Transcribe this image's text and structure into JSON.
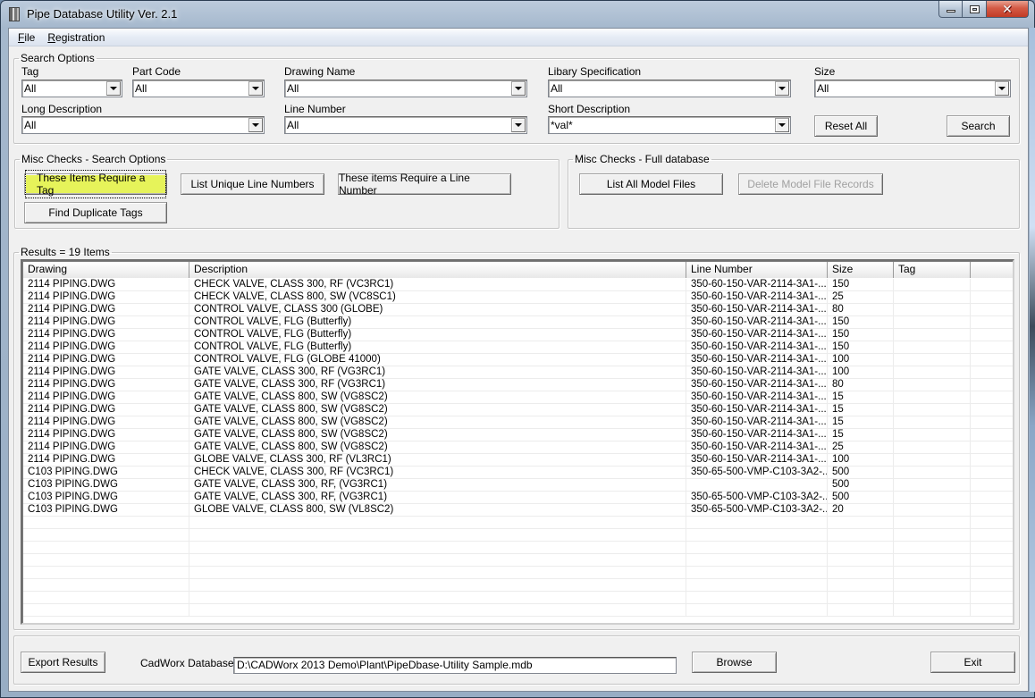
{
  "window": {
    "title": "Pipe Database Utility Ver. 2.1",
    "minimize_icon": "minimize-icon",
    "maximize_icon": "maximize-icon",
    "close_icon": "close-icon",
    "close_glyph": "✕"
  },
  "menu": {
    "items": [
      {
        "label": "File",
        "accel": "F",
        "rest": "ile"
      },
      {
        "label": "Registration",
        "accel": "R",
        "rest": "egistration"
      }
    ]
  },
  "search_options": {
    "legend": "Search Options",
    "fields": {
      "tag": {
        "label": "Tag",
        "value": "All"
      },
      "part_code": {
        "label": "Part Code",
        "value": "All"
      },
      "drawing_name": {
        "label": "Drawing Name",
        "value": "All"
      },
      "library_spec": {
        "label": "Libary Specification",
        "value": "All"
      },
      "size": {
        "label": "Size",
        "value": "All"
      },
      "long_description": {
        "label": "Long Description",
        "value": "All"
      },
      "line_number": {
        "label": "Line Number",
        "value": "All"
      },
      "short_description": {
        "label": "Short Description",
        "value": "*val*"
      }
    },
    "reset_label": "Reset All",
    "search_label": "Search"
  },
  "misc_search": {
    "legend": "Misc Checks - Search Options",
    "require_tag": "These Items Require a Tag",
    "unique_lines": "List Unique Line Numbers",
    "require_line": "These items Require a Line Number",
    "duplicate_tags": "Find Duplicate Tags"
  },
  "misc_full": {
    "legend": "Misc Checks - Full database",
    "list_models": "List All Model Files",
    "delete_records": "Delete Model File Records"
  },
  "results": {
    "legend": "Results = 19 Items",
    "columns": [
      "Drawing",
      "Description",
      "Line Number",
      "Size",
      "Tag",
      ""
    ],
    "rows": [
      [
        "2114 PIPING.DWG",
        "CHECK VALVE, CLASS 300, RF (VC3RC1)",
        "350-60-150-VAR-2114-3A1-...",
        "150",
        ""
      ],
      [
        "2114 PIPING.DWG",
        "CHECK VALVE, CLASS 800, SW (VC8SC1)",
        "350-60-150-VAR-2114-3A1-...",
        "25",
        ""
      ],
      [
        "2114 PIPING.DWG",
        "CONTROL VALVE, CLASS 300 (GLOBE)",
        "350-60-150-VAR-2114-3A1-...",
        "80",
        ""
      ],
      [
        "2114 PIPING.DWG",
        "CONTROL VALVE, FLG (Butterfly)",
        "350-60-150-VAR-2114-3A1-...",
        "150",
        ""
      ],
      [
        "2114 PIPING.DWG",
        "CONTROL VALVE, FLG (Butterfly)",
        "350-60-150-VAR-2114-3A1-...",
        "150",
        ""
      ],
      [
        "2114 PIPING.DWG",
        "CONTROL VALVE, FLG (Butterfly)",
        "350-60-150-VAR-2114-3A1-...",
        "150",
        ""
      ],
      [
        "2114 PIPING.DWG",
        "CONTROL VALVE, FLG (GLOBE 41000)",
        "350-60-150-VAR-2114-3A1-...",
        "100",
        ""
      ],
      [
        "2114 PIPING.DWG",
        "GATE VALVE, CLASS 300, RF (VG3RC1)",
        "350-60-150-VAR-2114-3A1-...",
        "100",
        ""
      ],
      [
        "2114 PIPING.DWG",
        "GATE VALVE, CLASS 300, RF (VG3RC1)",
        "350-60-150-VAR-2114-3A1-...",
        "80",
        ""
      ],
      [
        "2114 PIPING.DWG",
        "GATE VALVE, CLASS 800, SW (VG8SC2)",
        "350-60-150-VAR-2114-3A1-...",
        "15",
        ""
      ],
      [
        "2114 PIPING.DWG",
        "GATE VALVE, CLASS 800, SW (VG8SC2)",
        "350-60-150-VAR-2114-3A1-...",
        "15",
        ""
      ],
      [
        "2114 PIPING.DWG",
        "GATE VALVE, CLASS 800, SW (VG8SC2)",
        "350-60-150-VAR-2114-3A1-...",
        "15",
        ""
      ],
      [
        "2114 PIPING.DWG",
        "GATE VALVE, CLASS 800, SW (VG8SC2)",
        "350-60-150-VAR-2114-3A1-...",
        "15",
        ""
      ],
      [
        "2114 PIPING.DWG",
        "GATE VALVE, CLASS 800, SW (VG8SC2)",
        "350-60-150-VAR-2114-3A1-...",
        "25",
        ""
      ],
      [
        "2114 PIPING.DWG",
        "GLOBE VALVE, CLASS 300, RF (VL3RC1)",
        "350-60-150-VAR-2114-3A1-...",
        "100",
        ""
      ],
      [
        "C103 PIPING.DWG",
        "CHECK VALVE, CLASS 300, RF (VC3RC1)",
        "350-65-500-VMP-C103-3A2-...",
        "500",
        ""
      ],
      [
        "C103 PIPING.DWG",
        "GATE VALVE, CLASS 300, RF, (VG3RC1)",
        "",
        "500",
        ""
      ],
      [
        "C103 PIPING.DWG",
        "GATE VALVE, CLASS 300, RF, (VG3RC1)",
        "350-65-500-VMP-C103-3A2-...",
        "500",
        ""
      ],
      [
        "C103 PIPING.DWG",
        "GLOBE VALVE, CLASS 800, SW (VL8SC2)",
        "350-65-500-VMP-C103-3A2-...",
        "20",
        ""
      ]
    ],
    "empty_rows": 8
  },
  "footer": {
    "export_label": "Export Results",
    "db_label": "CadWorx Database:",
    "db_path": "D:\\CADWorx 2013 Demo\\Plant\\PipeDbase-Utility Sample.mdb",
    "browse_label": "Browse",
    "exit_label": "Exit"
  },
  "colors": {
    "highlight_button": "#e6f35a",
    "disabled_text": "#a0a0a0",
    "close_button": "#c13b25"
  }
}
